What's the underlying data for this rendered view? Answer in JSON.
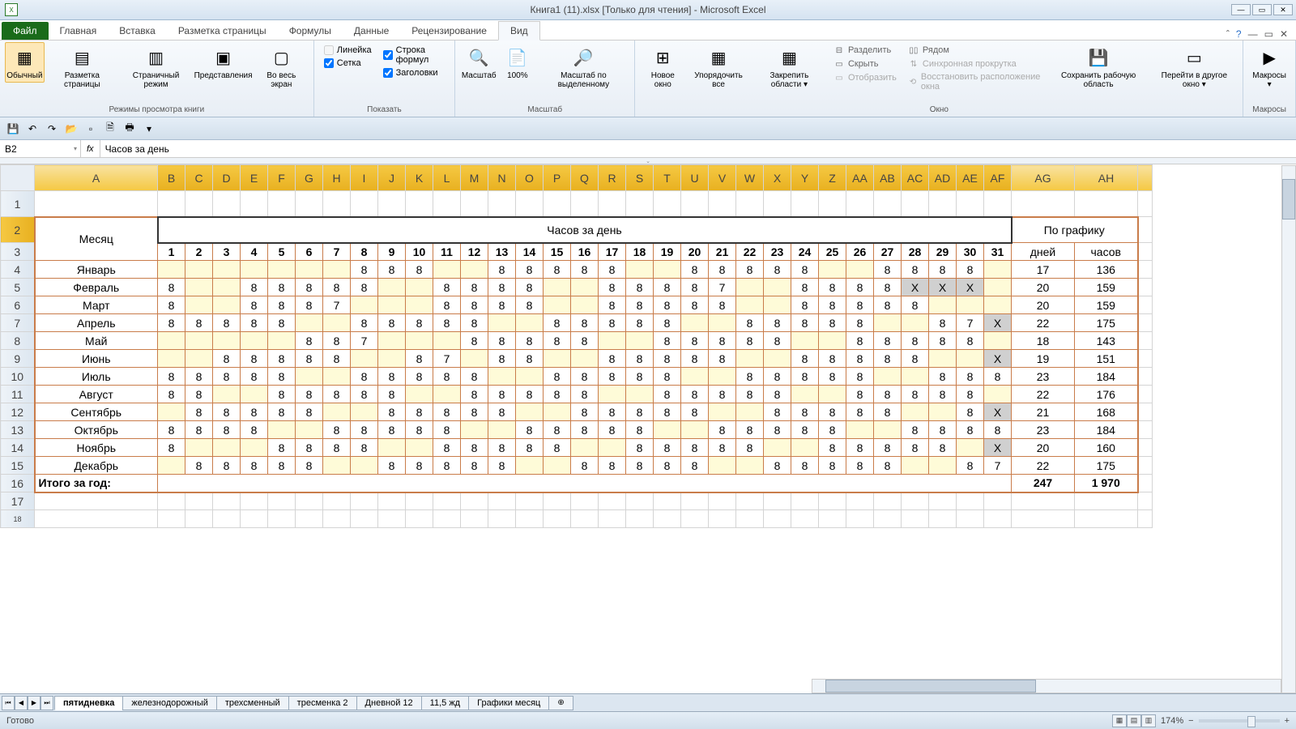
{
  "title": "Книга1 (11).xlsx  [Только для чтения]  -  Microsoft Excel",
  "tabs": {
    "file": "Файл",
    "home": "Главная",
    "insert": "Вставка",
    "layout": "Разметка страницы",
    "formulas": "Формулы",
    "data": "Данные",
    "review": "Рецензирование",
    "view": "Вид"
  },
  "ribbon": {
    "views": {
      "normal": "Обычный",
      "pagelayout": "Разметка страницы",
      "pagebreak": "Страничный режим",
      "custom": "Представления",
      "fullscreen": "Во весь экран",
      "group": "Режимы просмотра книги"
    },
    "show": {
      "ruler": "Линейка",
      "formula_bar": "Строка формул",
      "gridlines": "Сетка",
      "headings": "Заголовки",
      "group": "Показать"
    },
    "zoom": {
      "zoom": "Масштаб",
      "z100": "100%",
      "zsel": "Масштаб по выделенному",
      "group": "Масштаб"
    },
    "window": {
      "newwin": "Новое окно",
      "arrange": "Упорядочить все",
      "freeze": "Закрепить области",
      "split": "Разделить",
      "hide": "Скрыть",
      "unhide": "Отобразить",
      "sidebyside": "Рядом",
      "syncscroll": "Синхронная прокрутка",
      "resetpos": "Восстановить расположение окна",
      "savews": "Сохранить рабочую область",
      "switchwin": "Перейти в другое окно",
      "group": "Окно"
    },
    "macros": {
      "macros": "Макросы",
      "group": "Макросы"
    }
  },
  "namebox": "B2",
  "formula": "Часов за день",
  "columns": [
    "A",
    "B",
    "C",
    "D",
    "E",
    "F",
    "G",
    "H",
    "I",
    "J",
    "K",
    "L",
    "M",
    "N",
    "O",
    "P",
    "Q",
    "R",
    "S",
    "T",
    "U",
    "V",
    "W",
    "X",
    "Y",
    "Z",
    "AA",
    "AB",
    "AC",
    "AD",
    "AE",
    "AF",
    "AG",
    "AH"
  ],
  "headers": {
    "month": "Месяц",
    "hours_per_day": "Часов за день",
    "by_schedule": "По графику",
    "days": "дней",
    "hours": "часов",
    "total": "Итого за год:"
  },
  "day_nums": [
    1,
    2,
    3,
    4,
    5,
    6,
    7,
    8,
    9,
    10,
    11,
    12,
    13,
    14,
    15,
    16,
    17,
    18,
    19,
    20,
    21,
    22,
    23,
    24,
    25,
    26,
    27,
    28,
    29,
    30,
    31
  ],
  "months": [
    {
      "name": "Январь",
      "cells": [
        "",
        "",
        "",
        "",
        "",
        "",
        "",
        "8",
        "8",
        "8",
        "",
        "",
        "8",
        "8",
        "8",
        "8",
        "8",
        "",
        "",
        "8",
        "8",
        "8",
        "8",
        "8",
        "",
        "",
        "8",
        "8",
        "8",
        "8",
        ""
      ],
      "days": 17,
      "hours": 136
    },
    {
      "name": "Февраль",
      "cells": [
        "8",
        "",
        "",
        "8",
        "8",
        "8",
        "8",
        "8",
        "",
        "",
        "8",
        "8",
        "8",
        "8",
        "",
        "",
        "8",
        "8",
        "8",
        "8",
        "7",
        "",
        "",
        "8",
        "8",
        "8",
        "8",
        "X",
        "X",
        "X",
        ""
      ],
      "days": 20,
      "hours": 159
    },
    {
      "name": "Март",
      "cells": [
        "8",
        "",
        "",
        "8",
        "8",
        "8",
        "7",
        "",
        "",
        "",
        "8",
        "8",
        "8",
        "8",
        "",
        "",
        "8",
        "8",
        "8",
        "8",
        "8",
        "",
        "",
        "8",
        "8",
        "8",
        "8",
        "8",
        "",
        "",
        ""
      ],
      "days": 20,
      "hours": 159
    },
    {
      "name": "Апрель",
      "cells": [
        "8",
        "8",
        "8",
        "8",
        "8",
        "",
        "",
        "8",
        "8",
        "8",
        "8",
        "8",
        "",
        "",
        "8",
        "8",
        "8",
        "8",
        "8",
        "",
        "",
        "8",
        "8",
        "8",
        "8",
        "8",
        "",
        "",
        "8",
        "7",
        "X"
      ],
      "days": 22,
      "hours": 175
    },
    {
      "name": "Май",
      "cells": [
        "",
        "",
        "",
        "",
        "",
        "8",
        "8",
        "7",
        "",
        "",
        "",
        "8",
        "8",
        "8",
        "8",
        "8",
        "",
        "",
        "8",
        "8",
        "8",
        "8",
        "8",
        "",
        "",
        "8",
        "8",
        "8",
        "8",
        "8",
        ""
      ],
      "days": 18,
      "hours": 143
    },
    {
      "name": "Июнь",
      "cells": [
        "",
        "",
        "8",
        "8",
        "8",
        "8",
        "8",
        "",
        "",
        "8",
        "7",
        "",
        "8",
        "8",
        "",
        "",
        "8",
        "8",
        "8",
        "8",
        "8",
        "",
        "",
        "8",
        "8",
        "8",
        "8",
        "8",
        "",
        "",
        "X"
      ],
      "days": 19,
      "hours": 151
    },
    {
      "name": "Июль",
      "cells": [
        "8",
        "8",
        "8",
        "8",
        "8",
        "",
        "",
        "8",
        "8",
        "8",
        "8",
        "8",
        "",
        "",
        "8",
        "8",
        "8",
        "8",
        "8",
        "",
        "",
        "8",
        "8",
        "8",
        "8",
        "8",
        "",
        "",
        "8",
        "8",
        "8"
      ],
      "days": 23,
      "hours": 184
    },
    {
      "name": "Август",
      "cells": [
        "8",
        "8",
        "",
        "",
        "8",
        "8",
        "8",
        "8",
        "8",
        "",
        "",
        "8",
        "8",
        "8",
        "8",
        "8",
        "",
        "",
        "8",
        "8",
        "8",
        "8",
        "8",
        "",
        "",
        "8",
        "8",
        "8",
        "8",
        "8",
        ""
      ],
      "days": 22,
      "hours": 176
    },
    {
      "name": "Сентябрь",
      "cells": [
        "",
        "8",
        "8",
        "8",
        "8",
        "8",
        "",
        "",
        "8",
        "8",
        "8",
        "8",
        "8",
        "",
        "",
        "8",
        "8",
        "8",
        "8",
        "8",
        "",
        "",
        "8",
        "8",
        "8",
        "8",
        "8",
        "",
        "",
        "8",
        "X"
      ],
      "days": 21,
      "hours": 168
    },
    {
      "name": "Октябрь",
      "cells": [
        "8",
        "8",
        "8",
        "8",
        "",
        "",
        "8",
        "8",
        "8",
        "8",
        "8",
        "",
        "",
        "8",
        "8",
        "8",
        "8",
        "8",
        "",
        "",
        "8",
        "8",
        "8",
        "8",
        "8",
        "",
        "",
        "8",
        "8",
        "8",
        "8"
      ],
      "days": 23,
      "hours": 184
    },
    {
      "name": "Ноябрь",
      "cells": [
        "8",
        "",
        "",
        "",
        "8",
        "8",
        "8",
        "8",
        "",
        "",
        "8",
        "8",
        "8",
        "8",
        "8",
        "",
        "",
        "8",
        "8",
        "8",
        "8",
        "8",
        "",
        "",
        "8",
        "8",
        "8",
        "8",
        "8",
        "",
        "X"
      ],
      "days": 20,
      "hours": 160
    },
    {
      "name": "Декабрь",
      "cells": [
        "",
        "8",
        "8",
        "8",
        "8",
        "8",
        "",
        "",
        "8",
        "8",
        "8",
        "8",
        "8",
        "",
        "",
        "8",
        "8",
        "8",
        "8",
        "8",
        "",
        "",
        "8",
        "8",
        "8",
        "8",
        "8",
        "",
        "",
        "8",
        "7"
      ],
      "days": 22,
      "hours": 175
    }
  ],
  "yellow_days": {
    "Январь": [
      1,
      2,
      3,
      4,
      5,
      6,
      7,
      11,
      12,
      18,
      19,
      25,
      26,
      31
    ],
    "Февраль": [
      2,
      3,
      9,
      10,
      15,
      16,
      22,
      23,
      31
    ],
    "Март": [
      2,
      3,
      8,
      9,
      10,
      15,
      16,
      22,
      23,
      29,
      30,
      31
    ],
    "Апрель": [
      6,
      7,
      13,
      14,
      20,
      21,
      27,
      28
    ],
    "Май": [
      1,
      2,
      3,
      4,
      5,
      9,
      10,
      11,
      17,
      18,
      24,
      25,
      31
    ],
    "Июнь": [
      1,
      2,
      8,
      9,
      12,
      15,
      16,
      22,
      23,
      29,
      30
    ],
    "Июль": [
      6,
      7,
      13,
      14,
      20,
      21,
      27,
      28
    ],
    "Август": [
      3,
      4,
      10,
      11,
      17,
      18,
      24,
      25,
      31
    ],
    "Сентябрь": [
      1,
      7,
      8,
      14,
      15,
      21,
      22,
      28,
      29
    ],
    "Октябрь": [
      5,
      6,
      12,
      13,
      19,
      20,
      26,
      27
    ],
    "Ноябрь": [
      2,
      3,
      4,
      9,
      10,
      16,
      17,
      23,
      24,
      30
    ],
    "Декабрь": [
      1,
      7,
      8,
      14,
      15,
      21,
      22,
      28,
      29
    ]
  },
  "totals": {
    "days": 247,
    "hours": "1 970"
  },
  "sheets": [
    "пятидневка",
    "железнодорожный",
    "трехсменный",
    "тресменка 2",
    "Дневной 12",
    "11,5 жд",
    "Графики месяц"
  ],
  "status": "Готово",
  "zoom": "174%"
}
